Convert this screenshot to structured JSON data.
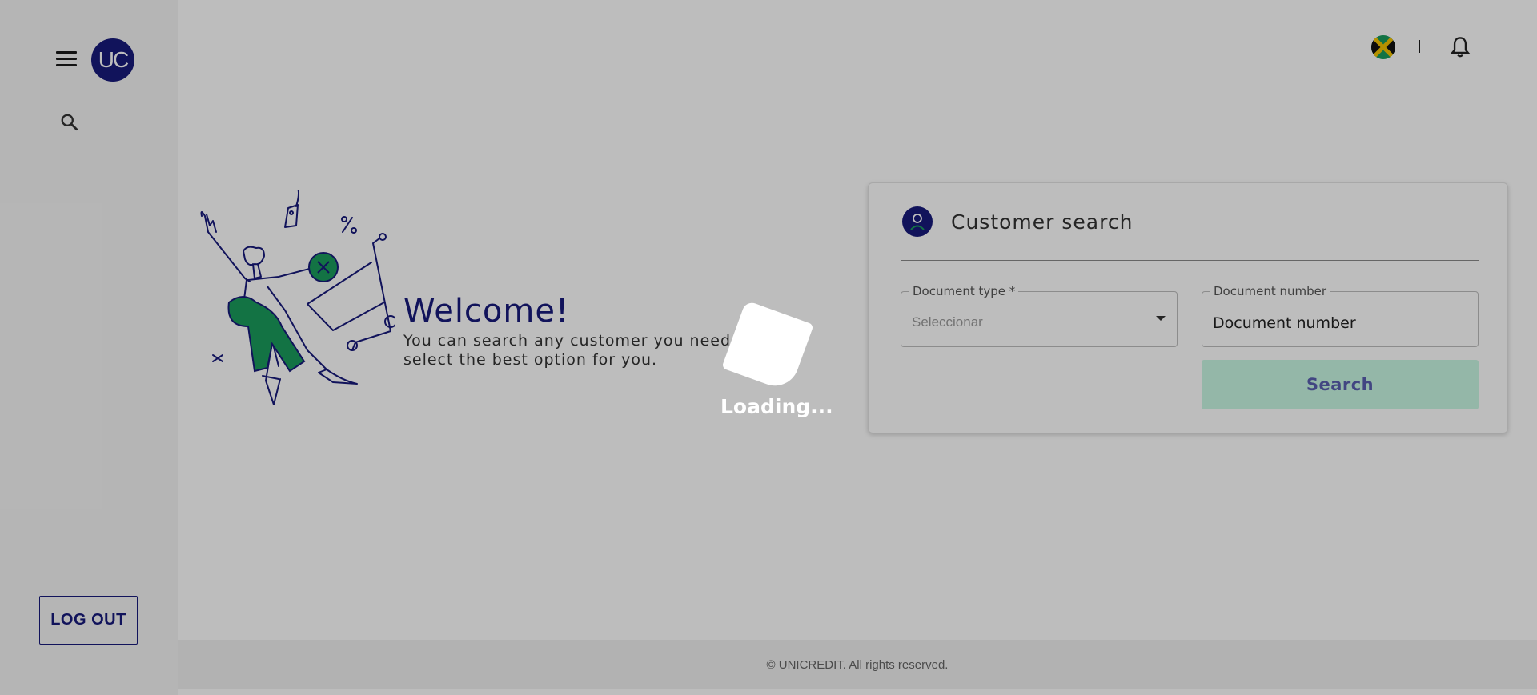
{
  "sidebar": {
    "menu_icon": "hamburger-menu-icon",
    "logo_text": "UC",
    "search_icon": "search-icon",
    "logout_label": "LOG OUT"
  },
  "header": {
    "flag": "jamaica-flag-icon",
    "divider": "|",
    "notification_icon": "bell-icon"
  },
  "welcome": {
    "title": "Welcome!",
    "text": "You can search any customer you need, please select the best option for you."
  },
  "customer_search": {
    "title": "Customer search",
    "icon": "user-icon",
    "document_type": {
      "label": "Document type *",
      "selected": "Seleccionar"
    },
    "document_number": {
      "label": "Document number",
      "placeholder": "Document number"
    },
    "search_label": "Search"
  },
  "footer": {
    "text": "© UNICREDIT. All rights reserved."
  },
  "loading": {
    "text": "Loading..."
  },
  "colors": {
    "brand_navy": "#181a7b",
    "brand_green": "#1a9c5c",
    "search_button_bg": "#c8f7e3"
  }
}
